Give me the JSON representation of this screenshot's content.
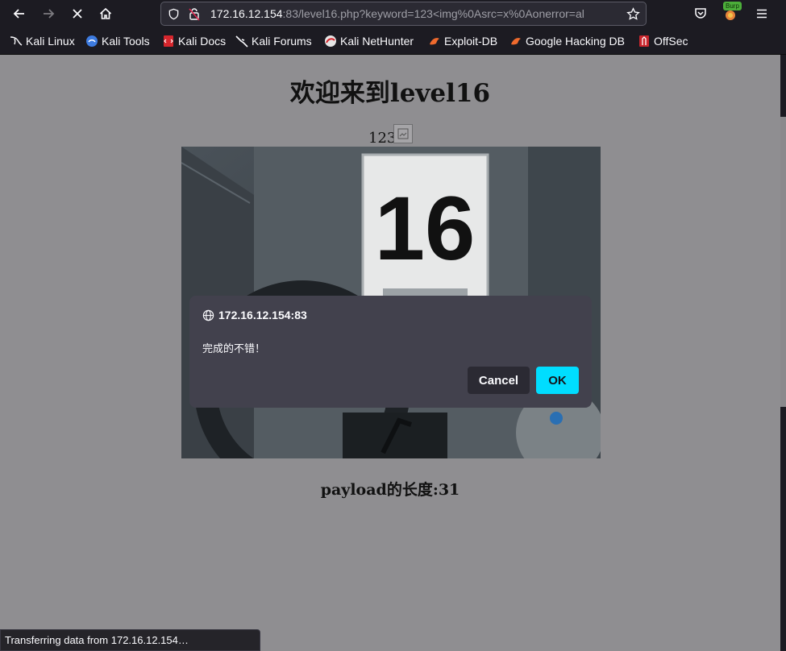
{
  "browser": {
    "url_host": "172.16.12.154",
    "url_rest": ":83/level16.php?keyword=123<img%0Asrc=x%0Aonerror=al",
    "burp_label": "Burp",
    "status_text": "Transferring data from 172.16.12.154…"
  },
  "bookmarks": [
    {
      "label": "Kali Linux",
      "icon": "kali-dragon-icon"
    },
    {
      "label": "Kali Tools",
      "icon": "kali-tools-icon"
    },
    {
      "label": "Kali Docs",
      "icon": "kali-docs-icon"
    },
    {
      "label": "Kali Forums",
      "icon": "kali-forums-icon"
    },
    {
      "label": "Kali NetHunter",
      "icon": "nethunter-icon"
    },
    {
      "label": "Exploit-DB",
      "icon": "exploit-db-icon"
    },
    {
      "label": "Google Hacking DB",
      "icon": "ghdb-icon"
    },
    {
      "label": "OffSec",
      "icon": "offsec-icon"
    }
  ],
  "page": {
    "title": "欢迎来到level16",
    "keyword": "123",
    "payload_length": "payload的长度:31",
    "sign_number": "16"
  },
  "dialog": {
    "origin": "172.16.12.154:83",
    "message": "完成的不错！",
    "cancel_label": "Cancel",
    "ok_label": "OK"
  }
}
